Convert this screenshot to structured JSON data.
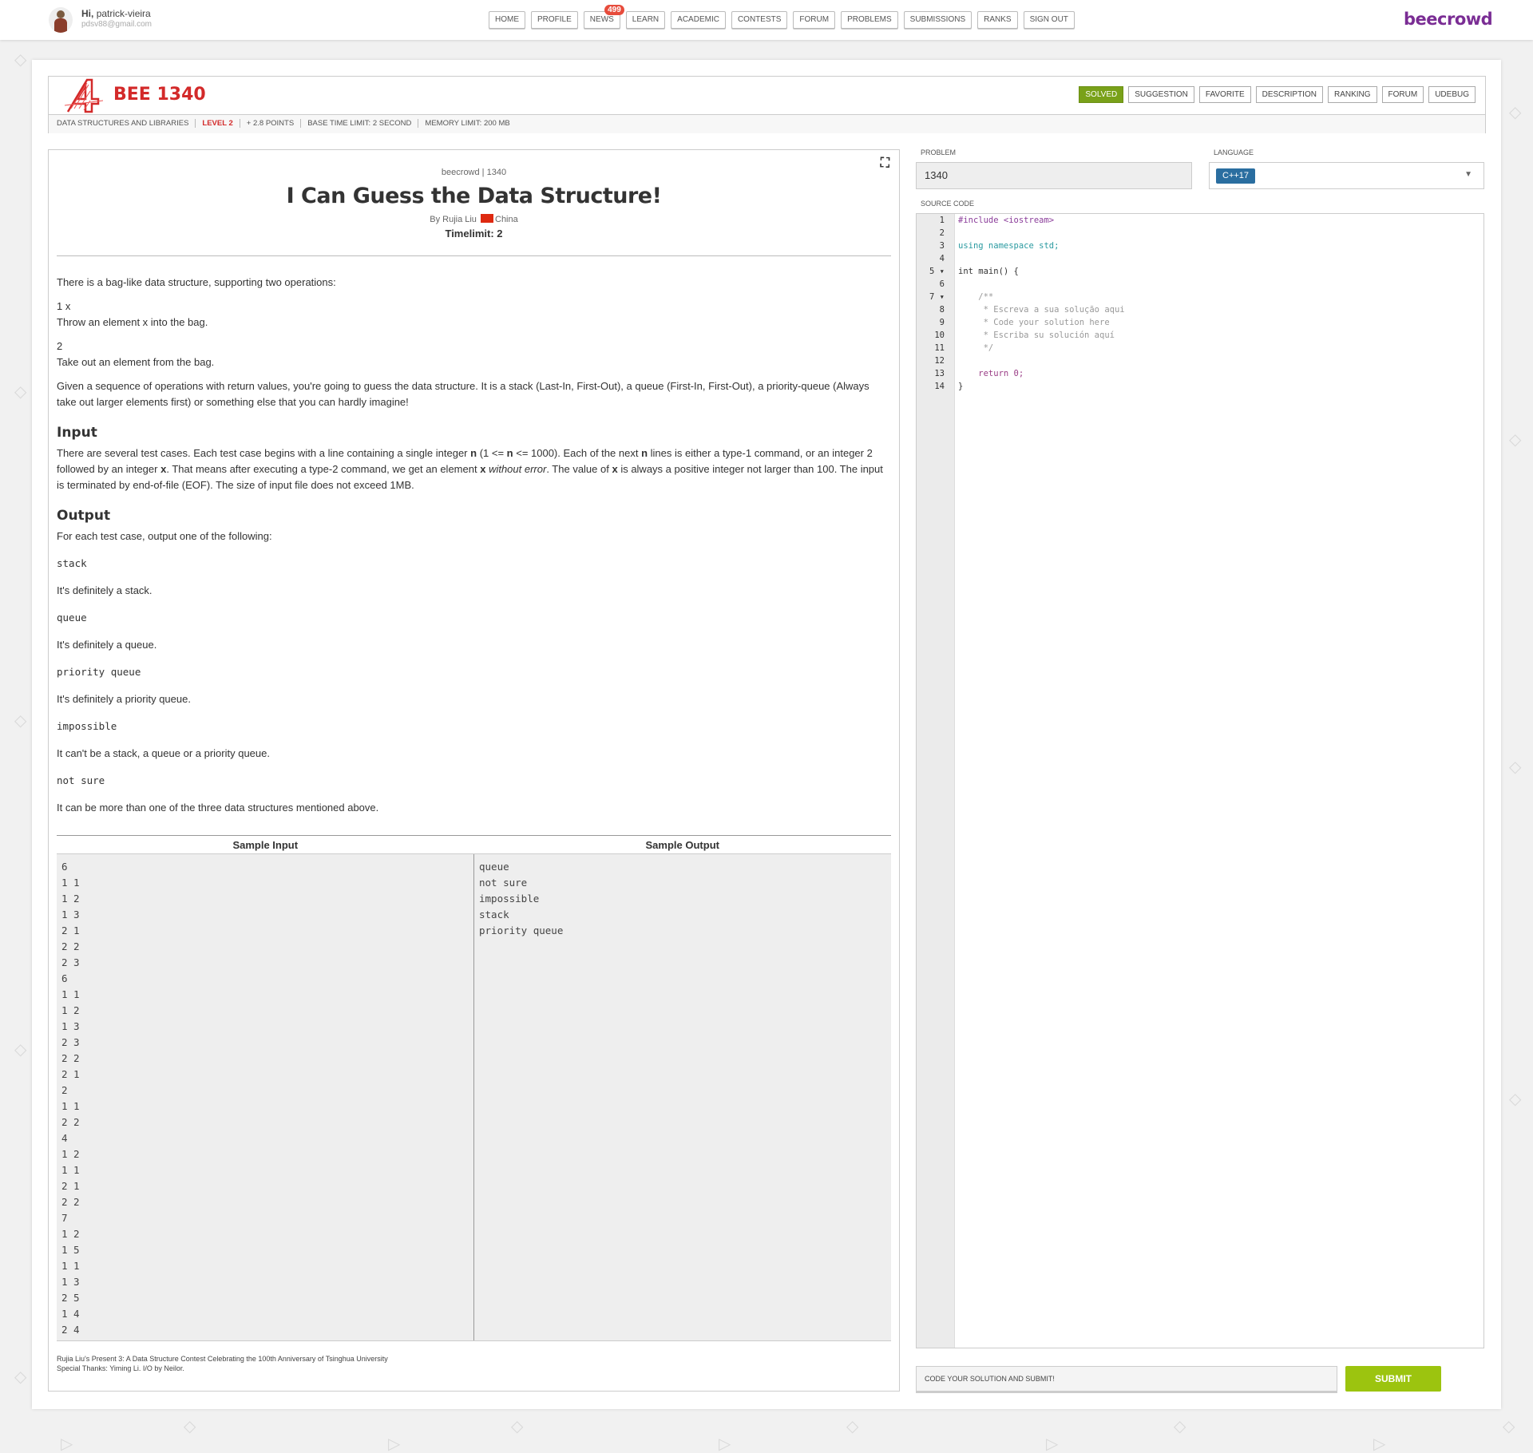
{
  "user": {
    "greeting": "Hi,",
    "name": "patrick-vieira",
    "email": "pdsv88@gmail.com"
  },
  "nav": [
    {
      "label": "HOME"
    },
    {
      "label": "PROFILE"
    },
    {
      "label": "NEWS",
      "badge": "499"
    },
    {
      "label": "LEARN"
    },
    {
      "label": "ACADEMIC"
    },
    {
      "label": "CONTESTS"
    },
    {
      "label": "FORUM"
    },
    {
      "label": "PROBLEMS"
    },
    {
      "label": "SUBMISSIONS"
    },
    {
      "label": "RANKS"
    },
    {
      "label": "SIGN OUT"
    }
  ],
  "brand": "beecrowd",
  "problem": {
    "code": "BEE 1340",
    "tabs": [
      "SOLVED",
      "SUGGESTION",
      "FAVORITE",
      "DESCRIPTION",
      "RANKING",
      "FORUM",
      "UDEBUG"
    ],
    "meta": {
      "category": "DATA STRUCTURES AND LIBRARIES",
      "level": "LEVEL 2",
      "points": "+ 2.8 POINTS",
      "time": "BASE TIME LIMIT: 2 SECOND",
      "memory": "MEMORY LIMIT: 200 MB"
    }
  },
  "statement": {
    "source": "beecrowd | 1340",
    "title": "I Can Guess the Data Structure!",
    "by": "By Rujia Liu",
    "country": "China",
    "timelimit": "Timelimit: 2",
    "intro": "There is a bag-like data structure, supporting two operations:",
    "op1_code": "1 x",
    "op1_desc": "Throw an element x into the bag.",
    "op2_code": "2",
    "op2_desc": "Take out an element from the bag.",
    "para": "Given a sequence of operations with return values, you're going to guess the data structure. It is a stack (Last-In, First-Out), a queue (First-In, First-Out), a priority-queue (Always take out larger elements first) or something else that you can hardly imagine!",
    "input_title": "Input",
    "input_1": "There are several test cases. Each test case begins with a line containing a single integer ",
    "input_n": "n",
    "input_2": " (1 <= ",
    "input_n2": "n",
    "input_3": " <= 1000). Each of the next ",
    "input_n3": "n",
    "input_4": " lines is either a type-1 command, or an integer 2 followed by an integer ",
    "input_x": "x",
    "input_5": ". That means after executing a type-2 command, we get an element ",
    "input_x2": "x",
    "input_6": " ",
    "input_em": "without error",
    "input_7": ". The value of ",
    "input_x3": "x",
    "input_8": " is always a positive integer not larger than 100. The input is terminated by end-of-file (EOF). The size of input file does not exceed 1MB.",
    "output_title": "Output",
    "output_intro": "For each test case, output one of the following:",
    "outputs": [
      {
        "code": "stack",
        "desc": "It's definitely a stack."
      },
      {
        "code": "queue",
        "desc": "It's definitely a queue."
      },
      {
        "code": "priority queue",
        "desc": "It's definitely a priority queue."
      },
      {
        "code": "impossible",
        "desc": "It can't be a stack, a queue or a priority queue."
      },
      {
        "code": "not sure",
        "desc": "It can be more than one of the three data structures mentioned above."
      }
    ],
    "sample_input_title": "Sample Input",
    "sample_output_title": "Sample Output",
    "sample_input": "6\n1 1\n1 2\n1 3\n2 1\n2 2\n2 3\n6\n1 1\n1 2\n1 3\n2 3\n2 2\n2 1\n2\n1 1\n2 2\n4\n1 2\n1 1\n2 1\n2 2\n7\n1 2\n1 5\n1 1\n1 3\n2 5\n1 4\n2 4",
    "sample_output": "queue\nnot sure\nimpossible\nstack\npriority queue",
    "credit_1": "Rujia Liu's Present 3: A Data Structure Contest Celebrating the 100th Anniversary of Tsinghua University",
    "credit_2": "Special Thanks: Yiming Li. I/O by Neilor."
  },
  "form": {
    "problem_label": "PROBLEM",
    "problem_value": "1340",
    "language_label": "LANGUAGE",
    "language_value": "C++17",
    "source_label": "SOURCE CODE",
    "submit_hint": "CODE YOUR SOLUTION AND SUBMIT!",
    "submit_label": "SUBMIT"
  },
  "code_lines": [
    "#include <iostream>",
    "",
    "using namespace std;",
    "",
    "int main() {",
    "",
    "    /**",
    "     * Escreva a sua solução aqui",
    "     * Code your solution here",
    "     * Escriba su solución aquí",
    "     */",
    "",
    "    return 0;",
    "}"
  ],
  "colors": {
    "accent": "#7a2d94",
    "problem_red": "#d32a2a",
    "solved_green": "#79a119",
    "submit_green": "#9cc40f",
    "lang_blue": "#2a6ea0"
  }
}
